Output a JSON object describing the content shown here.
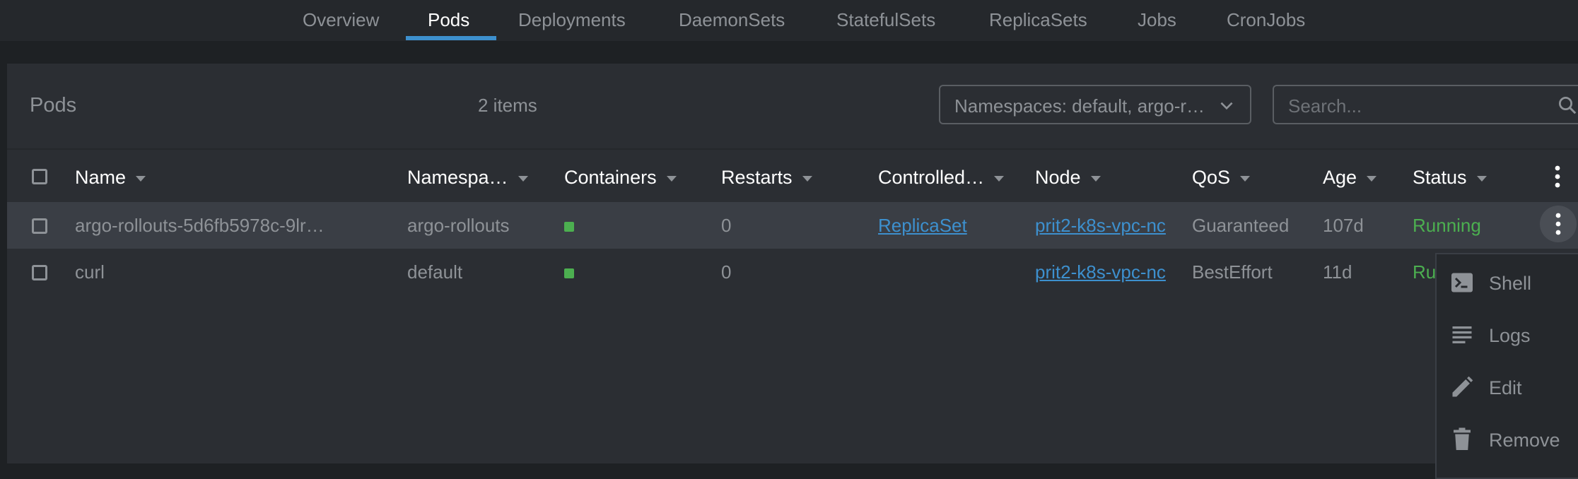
{
  "tabs": [
    {
      "label": "Overview"
    },
    {
      "label": "Pods"
    },
    {
      "label": "Deployments"
    },
    {
      "label": "DaemonSets"
    },
    {
      "label": "StatefulSets"
    },
    {
      "label": "ReplicaSets"
    },
    {
      "label": "Jobs"
    },
    {
      "label": "CronJobs"
    }
  ],
  "panel": {
    "title": "Pods",
    "items_count": "2 items",
    "namespace_filter": "Namespaces: default, argo-r…",
    "search_placeholder": "Search..."
  },
  "columns": {
    "name": "Name",
    "namespace": "Namespa…",
    "containers": "Containers",
    "restarts": "Restarts",
    "controlled_by": "Controlled…",
    "node": "Node",
    "qos": "QoS",
    "age": "Age",
    "status": "Status"
  },
  "rows": [
    {
      "name": "argo-rollouts-5d6fb5978c-9lr…",
      "namespace": "argo-rollouts",
      "restarts": "0",
      "controlled_by": "ReplicaSet",
      "node": "prit2-k8s-vpc-nc",
      "qos": "Guaranteed",
      "age": "107d",
      "status": "Running",
      "container_color": "#4caf50"
    },
    {
      "name": "curl",
      "namespace": "default",
      "restarts": "0",
      "controlled_by": "",
      "node": "prit2-k8s-vpc-nc",
      "qos": "BestEffort",
      "age": "11d",
      "status": "Ru",
      "container_color": "#4caf50"
    }
  ],
  "context_menu": [
    {
      "label": "Shell",
      "icon": "terminal-icon"
    },
    {
      "label": "Logs",
      "icon": "logs-icon"
    },
    {
      "label": "Edit",
      "icon": "pencil-icon"
    },
    {
      "label": "Remove",
      "icon": "trash-icon"
    }
  ],
  "colors": {
    "accent": "#3d90ce",
    "running": "#4caf50",
    "background": "#1e2124",
    "panel": "#2b2e33",
    "selected_row": "#3a3e45"
  }
}
